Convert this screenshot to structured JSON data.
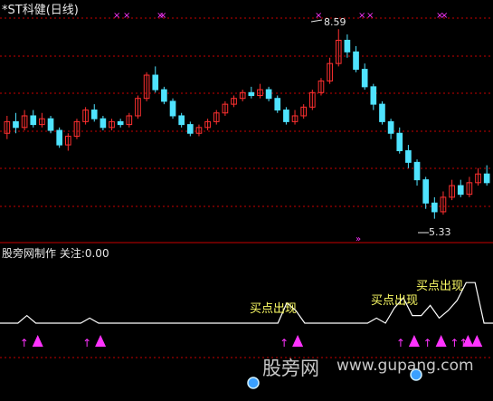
{
  "title": "*ST科健(日线)",
  "price_high_label": "8.59",
  "price_low_label": "5.33",
  "indicator_label": "股旁网制作 关注:0.00",
  "signal_labels": [
    "买点出现",
    "买点出现",
    "买点出现"
  ],
  "watermark": {
    "cn": "股旁网",
    "url": "www.gupang.com"
  },
  "colors": {
    "up": "#ff3030",
    "down": "#4fe3ff",
    "grid": "#c80000",
    "signal": "#ff33ff",
    "line": "#ffffff",
    "label": "#ffff66"
  },
  "icons": [
    "up-arrow-icon",
    "triangle-icon",
    "x-marker-icon",
    "double-chevron-icon",
    "blue-orb-icon"
  ],
  "chart_data": {
    "type": "candlestick",
    "price_extremes": {
      "high": 8.59,
      "low": 5.33
    },
    "candles": [
      {
        "o": 6.8,
        "c": 7.0,
        "h": 7.1,
        "l": 6.7
      },
      {
        "o": 7.0,
        "c": 6.9,
        "h": 7.15,
        "l": 6.8
      },
      {
        "o": 6.9,
        "c": 7.1,
        "h": 7.2,
        "l": 6.85
      },
      {
        "o": 7.1,
        "c": 6.95,
        "h": 7.2,
        "l": 6.9
      },
      {
        "o": 6.95,
        "c": 7.05,
        "h": 7.15,
        "l": 6.9
      },
      {
        "o": 7.05,
        "c": 6.85,
        "h": 7.1,
        "l": 6.8
      },
      {
        "o": 6.85,
        "c": 6.6,
        "h": 6.9,
        "l": 6.55
      },
      {
        "o": 6.6,
        "c": 6.75,
        "h": 6.8,
        "l": 6.5
      },
      {
        "o": 6.75,
        "c": 7.0,
        "h": 7.05,
        "l": 6.7
      },
      {
        "o": 7.0,
        "c": 7.2,
        "h": 7.25,
        "l": 6.95
      },
      {
        "o": 7.2,
        "c": 7.05,
        "h": 7.3,
        "l": 7.0
      },
      {
        "o": 7.05,
        "c": 6.9,
        "h": 7.1,
        "l": 6.85
      },
      {
        "o": 6.9,
        "c": 7.0,
        "h": 7.05,
        "l": 6.85
      },
      {
        "o": 7.0,
        "c": 6.95,
        "h": 7.05,
        "l": 6.9
      },
      {
        "o": 6.95,
        "c": 7.1,
        "h": 7.15,
        "l": 6.9
      },
      {
        "o": 7.1,
        "c": 7.4,
        "h": 7.45,
        "l": 7.05
      },
      {
        "o": 7.4,
        "c": 7.8,
        "h": 7.85,
        "l": 7.35
      },
      {
        "o": 7.8,
        "c": 7.55,
        "h": 7.95,
        "l": 7.5
      },
      {
        "o": 7.55,
        "c": 7.35,
        "h": 7.6,
        "l": 7.3
      },
      {
        "o": 7.35,
        "c": 7.1,
        "h": 7.4,
        "l": 7.05
      },
      {
        "o": 7.1,
        "c": 6.95,
        "h": 7.15,
        "l": 6.9
      },
      {
        "o": 6.95,
        "c": 6.8,
        "h": 7.0,
        "l": 6.75
      },
      {
        "o": 6.8,
        "c": 6.9,
        "h": 6.95,
        "l": 6.75
      },
      {
        "o": 6.9,
        "c": 7.0,
        "h": 7.05,
        "l": 6.85
      },
      {
        "o": 7.0,
        "c": 7.15,
        "h": 7.2,
        "l": 6.95
      },
      {
        "o": 7.15,
        "c": 7.3,
        "h": 7.35,
        "l": 7.1
      },
      {
        "o": 7.3,
        "c": 7.4,
        "h": 7.45,
        "l": 7.25
      },
      {
        "o": 7.4,
        "c": 7.5,
        "h": 7.55,
        "l": 7.35
      },
      {
        "o": 7.5,
        "c": 7.45,
        "h": 7.6,
        "l": 7.4
      },
      {
        "o": 7.45,
        "c": 7.55,
        "h": 7.65,
        "l": 7.4
      },
      {
        "o": 7.55,
        "c": 7.4,
        "h": 7.6,
        "l": 7.35
      },
      {
        "o": 7.4,
        "c": 7.2,
        "h": 7.45,
        "l": 7.15
      },
      {
        "o": 7.2,
        "c": 7.0,
        "h": 7.25,
        "l": 6.95
      },
      {
        "o": 7.0,
        "c": 7.1,
        "h": 7.2,
        "l": 6.95
      },
      {
        "o": 7.1,
        "c": 7.25,
        "h": 7.3,
        "l": 7.05
      },
      {
        "o": 7.25,
        "c": 7.5,
        "h": 7.55,
        "l": 7.2
      },
      {
        "o": 7.5,
        "c": 7.7,
        "h": 7.75,
        "l": 7.45
      },
      {
        "o": 7.7,
        "c": 8.0,
        "h": 8.1,
        "l": 7.65
      },
      {
        "o": 8.0,
        "c": 8.4,
        "h": 8.59,
        "l": 7.95
      },
      {
        "o": 8.4,
        "c": 8.2,
        "h": 8.5,
        "l": 8.1
      },
      {
        "o": 8.2,
        "c": 7.9,
        "h": 8.3,
        "l": 7.85
      },
      {
        "o": 7.9,
        "c": 7.6,
        "h": 8.0,
        "l": 7.55
      },
      {
        "o": 7.6,
        "c": 7.3,
        "h": 7.65,
        "l": 7.2
      },
      {
        "o": 7.3,
        "c": 7.0,
        "h": 7.35,
        "l": 6.95
      },
      {
        "o": 7.0,
        "c": 6.8,
        "h": 7.05,
        "l": 6.7
      },
      {
        "o": 6.8,
        "c": 6.5,
        "h": 6.9,
        "l": 6.45
      },
      {
        "o": 6.5,
        "c": 6.3,
        "h": 6.6,
        "l": 6.2
      },
      {
        "o": 6.3,
        "c": 6.0,
        "h": 6.35,
        "l": 5.9
      },
      {
        "o": 6.0,
        "c": 5.6,
        "h": 6.05,
        "l": 5.5
      },
      {
        "o": 5.6,
        "c": 5.45,
        "h": 5.7,
        "l": 5.33
      },
      {
        "o": 5.45,
        "c": 5.7,
        "h": 5.8,
        "l": 5.4
      },
      {
        "o": 5.7,
        "c": 5.9,
        "h": 6.0,
        "l": 5.65
      },
      {
        "o": 5.9,
        "c": 5.75,
        "h": 6.0,
        "l": 5.7
      },
      {
        "o": 5.75,
        "c": 5.95,
        "h": 6.05,
        "l": 5.7
      },
      {
        "o": 5.95,
        "c": 6.1,
        "h": 6.2,
        "l": 5.9
      },
      {
        "o": 6.1,
        "c": 5.95,
        "h": 6.25,
        "l": 5.9
      }
    ],
    "indicator": {
      "line": [
        0,
        0,
        0,
        0.3,
        0,
        0,
        0,
        0,
        0,
        0,
        0.2,
        0,
        0,
        0,
        0,
        0,
        0,
        0,
        0,
        0,
        0,
        0,
        0,
        0,
        0,
        0,
        0,
        0,
        0,
        0,
        0,
        0,
        0.8,
        0.5,
        0,
        0,
        0,
        0,
        0,
        0,
        0,
        0,
        0.2,
        0,
        0.6,
        1.0,
        0.3,
        0.3,
        0.7,
        0.2,
        0.5,
        0.9,
        1.6,
        1.6,
        0,
        0
      ],
      "signal_indices": [
        3,
        10,
        32,
        45,
        48,
        51,
        52
      ]
    }
  }
}
